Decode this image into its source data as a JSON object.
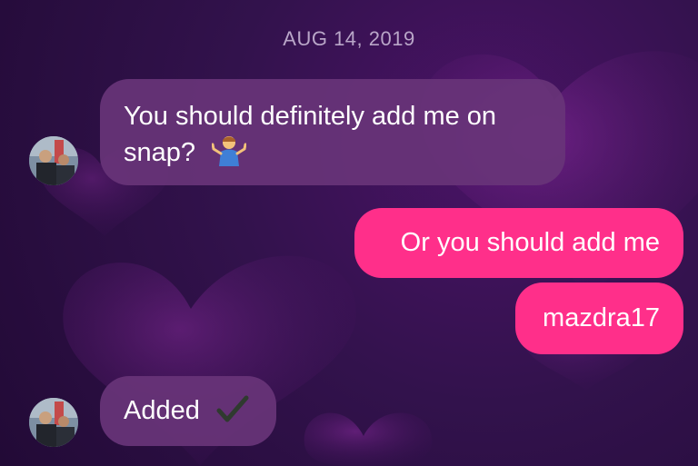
{
  "thread": {
    "date_label": "AUG 14, 2019"
  },
  "messages": [
    {
      "from": "them",
      "text_line1": "You should definitely add me on",
      "text_line2": "snap?",
      "emoji": "person-shrugging-emoji"
    },
    {
      "from": "me",
      "text": "Or you should add me"
    },
    {
      "from": "me",
      "text": "mazdra17"
    },
    {
      "from": "them",
      "text": "Added",
      "emoji": "check-mark-icon"
    }
  ],
  "colors": {
    "outgoing_bubble": "#ff2f8a",
    "incoming_bubble": "#683478",
    "background": "#2b0e40"
  }
}
